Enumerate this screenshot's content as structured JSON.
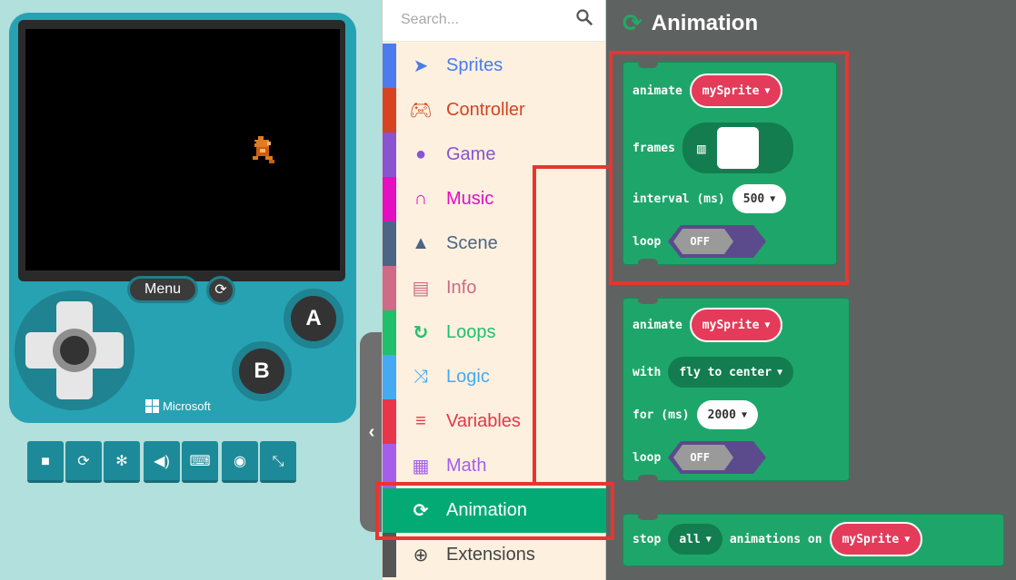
{
  "simulator": {
    "menu_label": "Menu",
    "btn_a_label": "A",
    "btn_b_label": "B",
    "brand_label": "Microsoft",
    "toolbar_icons": [
      "stop-icon",
      "restart-icon",
      "debug-icon",
      "sound-icon",
      "keyboard-icon",
      "screenshot-icon",
      "fullscreen-icon"
    ]
  },
  "toolbox": {
    "search_placeholder": "Search...",
    "categories": [
      {
        "label": "Sprites",
        "color": "#4b7bec",
        "icon": "paper-plane-icon"
      },
      {
        "label": "Controller",
        "color": "#d54322",
        "icon": "gamepad-icon"
      },
      {
        "label": "Game",
        "color": "#8854d0",
        "icon": "circle-icon"
      },
      {
        "label": "Music",
        "color": "#e30fc0",
        "icon": "headphones-icon"
      },
      {
        "label": "Scene",
        "color": "#4b6584",
        "icon": "tree-icon"
      },
      {
        "label": "Info",
        "color": "#cf6a87",
        "icon": "id-card-icon"
      },
      {
        "label": "Loops",
        "color": "#20bf6b",
        "icon": "loop-arrow-icon"
      },
      {
        "label": "Logic",
        "color": "#45aaf2",
        "icon": "shuffle-icon"
      },
      {
        "label": "Variables",
        "color": "#e8354a",
        "icon": "list-icon"
      },
      {
        "label": "Math",
        "color": "#a55eea",
        "icon": "calculator-icon"
      },
      {
        "label": "Animation",
        "color": "#03aa74",
        "icon": "sync-icon"
      },
      {
        "label": "Extensions",
        "color": "#555555",
        "icon": "plus-circle-icon"
      }
    ]
  },
  "workspace": {
    "title": "Animation",
    "block1": {
      "animate_label": "animate",
      "sprite_value": "mySprite",
      "frames_label": "frames",
      "interval_label": "interval (ms)",
      "interval_value": "500",
      "loop_label": "loop",
      "loop_value": "OFF"
    },
    "block2": {
      "animate_label": "animate",
      "sprite_value": "mySprite",
      "with_label": "with",
      "with_value": "fly to center",
      "for_label": "for (ms)",
      "for_value": "2000",
      "loop_label": "loop",
      "loop_value": "OFF"
    },
    "block3": {
      "stop_label": "stop",
      "stop_value": "all",
      "animations_on_label": "animations on",
      "sprite_value": "mySprite"
    }
  }
}
